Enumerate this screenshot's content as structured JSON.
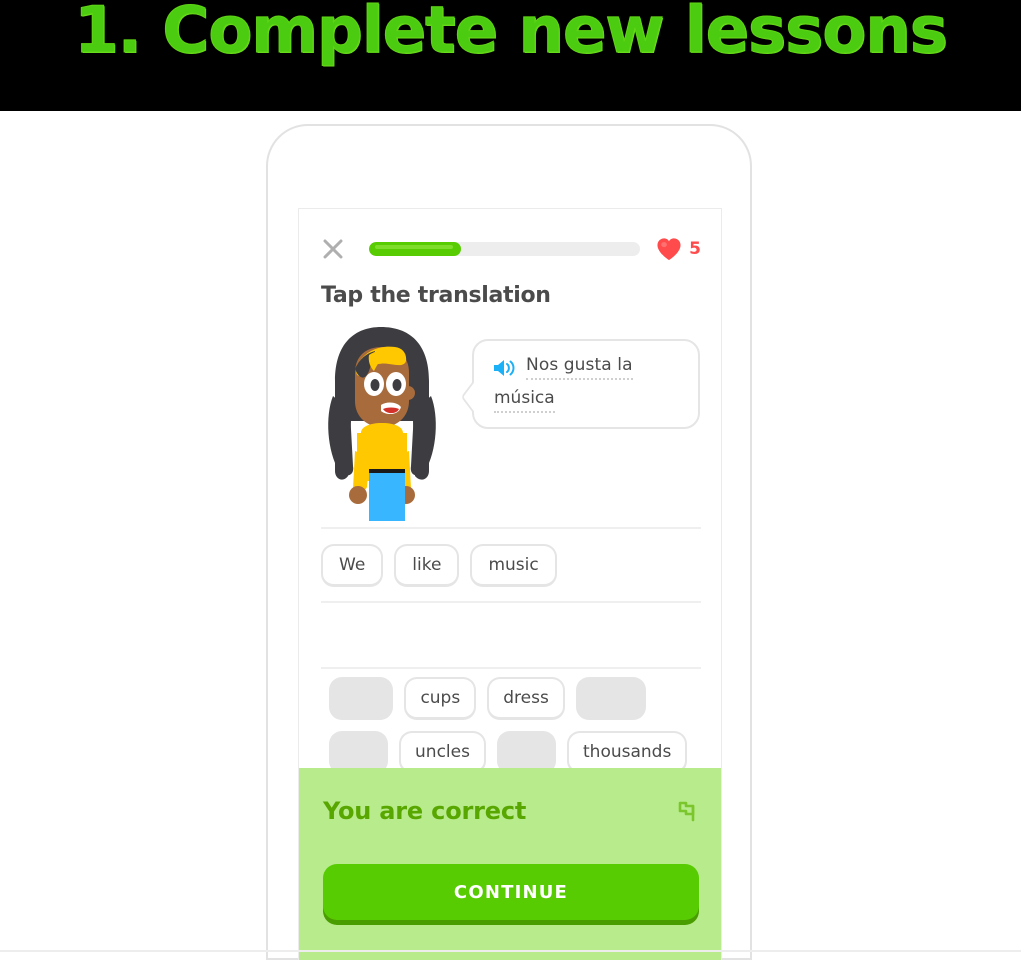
{
  "header": {
    "title": "1. Complete new lessons",
    "background_color": "#000000",
    "text_color": "#4ccc10"
  },
  "lesson": {
    "close_icon": "close-x-icon",
    "progress": {
      "percent": 34,
      "fill_color": "#58cc02",
      "track_color": "#ededed"
    },
    "hearts": {
      "icon": "heart-icon",
      "count": "5",
      "color": "#ff4b4b"
    },
    "prompt": "Tap the translation",
    "character": {
      "name": "female-learner-character",
      "hair_color": "#3c3c41",
      "headband_color": "#ffc800",
      "skin_color": "#a86b3c",
      "shirt_color": "#ffc800",
      "skirt_color": "#38b6ff"
    },
    "bubble": {
      "speaker_icon": "speaker-icon",
      "speaker_color": "#1cb0f6",
      "line1": "Nos gusta la",
      "line2": "música"
    },
    "answer": {
      "tiles": [
        "We",
        "like",
        "music"
      ],
      "line2_tiles": []
    },
    "word_bank": {
      "row1": [
        {
          "label": "",
          "used": true
        },
        {
          "label": "cups",
          "used": false
        },
        {
          "label": "dress",
          "used": false
        },
        {
          "label": "",
          "used": true
        }
      ],
      "row2": [
        {
          "label": "",
          "used": true
        },
        {
          "label": "uncles",
          "used": false
        },
        {
          "label": "",
          "used": true
        },
        {
          "label": "thousands",
          "used": false
        }
      ]
    },
    "feedback": {
      "message": "You are correct",
      "background_color": "#b8eb8c",
      "text_color": "#58a700",
      "flag_icon": "flag-icon",
      "continue_label": "CONTINUE",
      "continue_color": "#58cc02"
    }
  }
}
